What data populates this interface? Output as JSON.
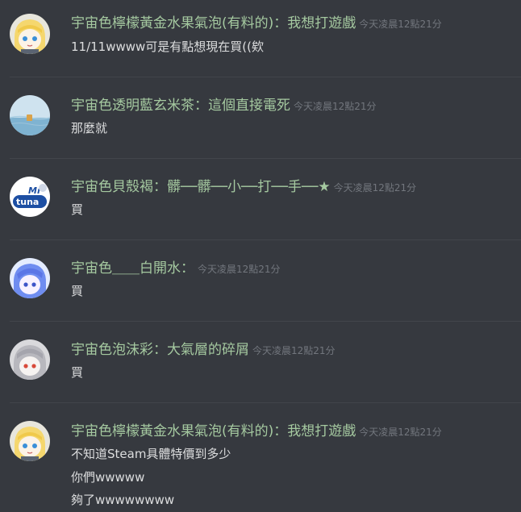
{
  "messages": [
    {
      "avatar": "blonde-anime-girl-avatar",
      "author": "宇宙色檸檬黃金水果氣泡(有料的)：我想打遊戲",
      "timestamp": "今天凌晨12點21分",
      "lines": [
        "11/11wwww可是有點想現在買((欸"
      ]
    },
    {
      "avatar": "sky-water-avatar",
      "author": "宇宙色透明藍玄米茶：這個直接電死",
      "timestamp": "今天凌晨12點21分",
      "lines": [
        "那麼就"
      ]
    },
    {
      "avatar": "mr-tuna-logo-avatar",
      "author": "宇宙色貝殼褐：髒──髒──小──打──手──★",
      "timestamp": "今天凌晨12點21分",
      "lines": [
        "買"
      ]
    },
    {
      "avatar": "blue-hair-character-avatar",
      "author": "宇宙色＿＿白開水：",
      "timestamp": "今天凌晨12點21分",
      "lines": [
        "買"
      ]
    },
    {
      "avatar": "gray-hair-character-avatar",
      "author": "宇宙色泡沫彩：大氣層的碎屑",
      "timestamp": "今天凌晨12點21分",
      "lines": [
        "買"
      ]
    },
    {
      "avatar": "blonde-anime-girl-avatar",
      "author": "宇宙色檸檬黃金水果氣泡(有料的)：我想打遊戲",
      "timestamp": "今天凌晨12點21分",
      "lines": [
        "不知道Steam具體特價到多少",
        "你們wwwww",
        "夠了wwwwwwww"
      ]
    }
  ],
  "colors": {
    "background": "#36393f",
    "author": "#a5c9a0",
    "timestamp": "#72767d",
    "text": "#dcddde",
    "divider": "#42454b"
  }
}
